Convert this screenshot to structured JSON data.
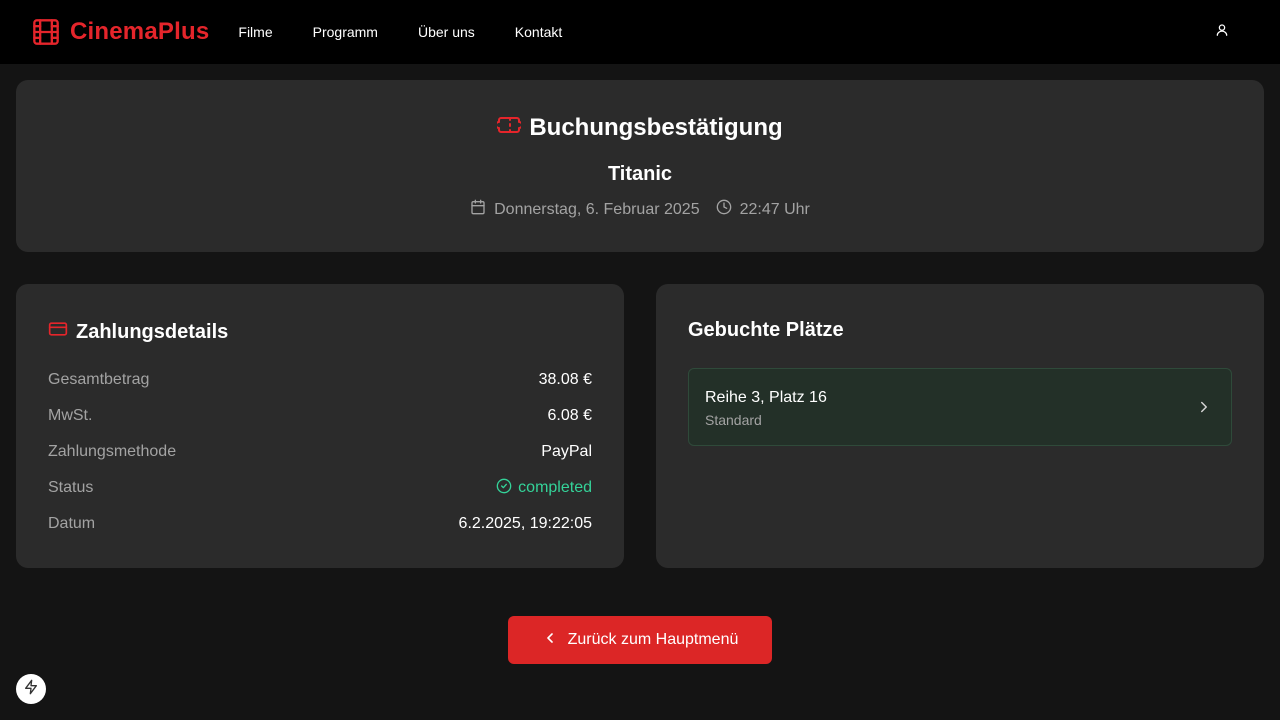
{
  "header": {
    "brand": "CinemaPlus",
    "nav": [
      "Filme",
      "Programm",
      "Über uns",
      "Kontakt"
    ]
  },
  "confirmation": {
    "title": "Buchungsbestätigung",
    "movie": "Titanic",
    "date": "Donnerstag, 6. Februar 2025",
    "time": "22:47 Uhr"
  },
  "payment": {
    "title": "Zahlungsdetails",
    "rows": [
      {
        "label": "Gesamtbetrag",
        "value": "38.08 €"
      },
      {
        "label": "MwSt.",
        "value": "6.08 €"
      },
      {
        "label": "Zahlungsmethode",
        "value": "PayPal"
      },
      {
        "label": "Status",
        "value": "completed"
      },
      {
        "label": "Datum",
        "value": "6.2.2025, 19:22:05"
      }
    ]
  },
  "seats": {
    "title": "Gebuchte Plätze",
    "items": [
      {
        "name": "Reihe 3, Platz 16",
        "type": "Standard"
      }
    ]
  },
  "back_button": "Zurück zum Hauptmenü",
  "icons": {
    "brand": "film-icon",
    "user": "user-icon",
    "ticket": "ticket-icon",
    "calendar": "calendar-icon",
    "clock": "clock-icon",
    "card": "credit-card-icon",
    "status": "check-circle-icon",
    "seat_chevron": "chevron-right-icon",
    "back": "chevron-left-icon",
    "fab": "lightning-icon"
  },
  "colors": {
    "accent": "#e5252b",
    "button": "#dc2626",
    "success": "#34d399",
    "seat_bg": "#233028"
  }
}
